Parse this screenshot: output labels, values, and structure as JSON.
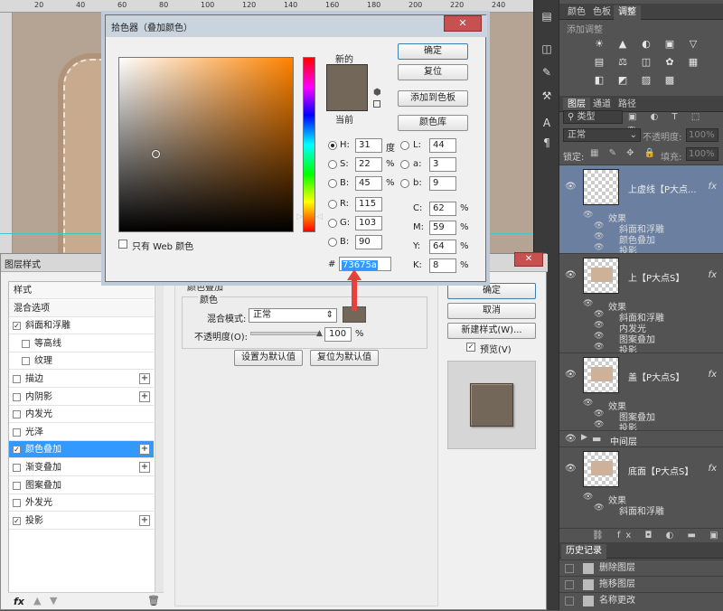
{
  "ruler": {
    "ticks": [
      "20",
      "40",
      "60",
      "80",
      "100",
      "120",
      "140",
      "160",
      "180",
      "200",
      "220",
      "240"
    ]
  },
  "panels": {
    "top_tabs": [
      {
        "label": "颜色"
      },
      {
        "label": "色板"
      },
      {
        "label": "调整"
      }
    ],
    "adjustments_hint": "添加调整",
    "adjust_icons_row1": [
      "☀",
      "▲",
      "◐",
      "▣",
      "▽"
    ],
    "adjust_icons_row2": [
      "▤",
      "⚖",
      "◫",
      "✿",
      "▦"
    ],
    "adjust_icons_row3": [
      "◧",
      "◩",
      "▨",
      "▩"
    ],
    "layer_tabs": [
      {
        "label": "图层"
      },
      {
        "label": "通道"
      },
      {
        "label": "路径"
      }
    ],
    "filter_label": "类型",
    "blend_mode": "正常",
    "opacity_label": "不透明度:",
    "opacity_value": "100%",
    "lock_label": "锁定:",
    "fill_label": "填充:",
    "fill_value": "100%",
    "layers": [
      {
        "name": "上虚线【P大点...",
        "fx": "fx",
        "effects_label": "效果",
        "effects": [
          "斜面和浮雕",
          "颜色叠加",
          "投影"
        ]
      },
      {
        "name": "上【P大点S】",
        "fx": "fx",
        "effects_label": "效果",
        "effects": [
          "斜面和浮雕",
          "内发光",
          "图案叠加",
          "投影"
        ]
      },
      {
        "name": "盖【P大点S】",
        "fx": "fx",
        "effects_label": "效果",
        "effects": [
          "图案叠加",
          "投影"
        ]
      },
      {
        "name": "中间层"
      },
      {
        "name": "底面【P大点S】",
        "fx": "fx",
        "effects_label": "效果",
        "effects": [
          "斜面和浮雕"
        ]
      }
    ],
    "history_tab": "历史记录",
    "history": [
      {
        "label": "删除图层"
      },
      {
        "label": "拖移图层"
      },
      {
        "label": "名称更改"
      }
    ]
  },
  "layer_style": {
    "title": "图层样式",
    "items": [
      {
        "label": "样式",
        "type": "head"
      },
      {
        "label": "混合选项",
        "type": "head"
      },
      {
        "label": "斜面和浮雕",
        "checked": true
      },
      {
        "label": "等高线",
        "checked": false,
        "indent": true
      },
      {
        "label": "纹理",
        "checked": false,
        "indent": true
      },
      {
        "label": "描边",
        "checked": false,
        "plus": true
      },
      {
        "label": "内阴影",
        "checked": false,
        "plus": true
      },
      {
        "label": "内发光",
        "checked": false
      },
      {
        "label": "光泽",
        "checked": false
      },
      {
        "label": "颜色叠加",
        "checked": true,
        "plus": true,
        "selected": true
      },
      {
        "label": "渐变叠加",
        "checked": false,
        "plus": true
      },
      {
        "label": "图案叠加",
        "checked": false
      },
      {
        "label": "外发光",
        "checked": false
      },
      {
        "label": "投影",
        "checked": true,
        "plus": true
      }
    ],
    "fx_label": "fx",
    "section_title": "颜色叠加",
    "group_title": "颜色",
    "blend_label": "混合模式:",
    "blend_value": "正常",
    "opacity_label": "不透明度(O):",
    "opacity_value": "100",
    "opacity_unit": "%",
    "opacity_fraction": 1.0,
    "set_default": "设置为默认值",
    "reset_default": "复位为默认值",
    "ok": "确定",
    "cancel": "取消",
    "new_style": "新建样式(W)...",
    "preview": "预览(V)",
    "overlay_color": "#73675a"
  },
  "color_picker": {
    "title": "拾色器（叠加颜色）",
    "new_label": "新的",
    "current_label": "当前",
    "ok": "确定",
    "reset": "复位",
    "add_swatch": "添加到色板",
    "library": "颜色库",
    "web_only": "只有 Web 颜色",
    "hsb": [
      {
        "key": "H:",
        "value": "31",
        "unit": "度",
        "selected": true
      },
      {
        "key": "S:",
        "value": "22",
        "unit": "%"
      },
      {
        "key": "B:",
        "value": "45",
        "unit": "%"
      }
    ],
    "rgb": [
      {
        "key": "R:",
        "value": "115"
      },
      {
        "key": "G:",
        "value": "103"
      },
      {
        "key": "B:",
        "value": "90"
      }
    ],
    "lab": [
      {
        "key": "L:",
        "value": "44"
      },
      {
        "key": "a:",
        "value": "3"
      },
      {
        "key": "b:",
        "value": "9"
      }
    ],
    "cmyk": [
      {
        "key": "C:",
        "value": "62",
        "unit": "%"
      },
      {
        "key": "M:",
        "value": "59",
        "unit": "%"
      },
      {
        "key": "Y:",
        "value": "64",
        "unit": "%"
      },
      {
        "key": "K:",
        "value": "8",
        "unit": "%"
      }
    ],
    "hex_label": "#",
    "hex": "73675a",
    "new_color": "#73675a",
    "current_color": "#73675a"
  }
}
